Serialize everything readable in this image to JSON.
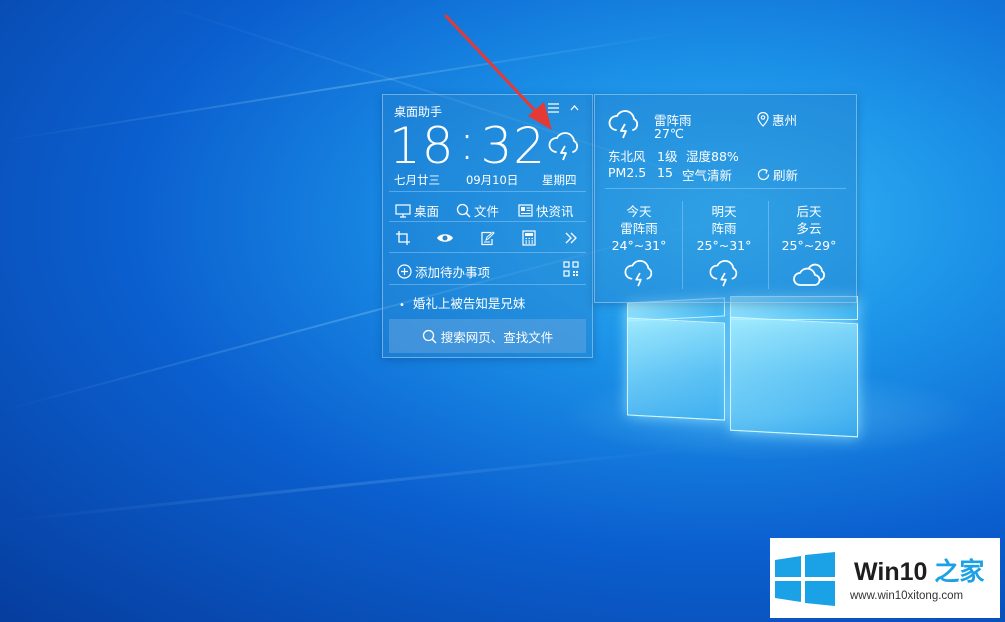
{
  "assistant": {
    "title": "桌面助手",
    "time_hour": "18",
    "time_sep": ":",
    "time_min": "32",
    "lunar_date": "七月廿三",
    "date": "09月10日",
    "weekday": "星期四",
    "nav": [
      {
        "label": "桌面",
        "icon": "monitor-icon"
      },
      {
        "label": "文件",
        "icon": "search-icon"
      },
      {
        "label": "快资讯",
        "icon": "news-icon"
      }
    ],
    "tools": [
      "crop-icon",
      "eye-icon",
      "edit-icon",
      "calculator-icon",
      "double-chevron-right-icon"
    ],
    "todo_label": "添加待办事项",
    "note_bullet": "•",
    "note": "婚礼上被告知是兄妹",
    "search_label": "搜索网页、查找文件"
  },
  "weather": {
    "condition": "雷阵雨",
    "temperature": "27℃",
    "location": "惠州",
    "wind_dir": "东北风",
    "wind_level": "1级",
    "humidity": "湿度88%",
    "pm_label": "PM2.5",
    "pm_value": "15",
    "air_quality": "空气清新",
    "refresh_label": "刷新",
    "forecast": [
      {
        "day": "今天",
        "condition": "雷阵雨",
        "range": "24°~31°",
        "icon": "thunderstorm-icon"
      },
      {
        "day": "明天",
        "condition": "阵雨",
        "range": "25°~31°",
        "icon": "thunderstorm-icon"
      },
      {
        "day": "后天",
        "condition": "多云",
        "range": "25°~29°",
        "icon": "cloudy-icon"
      }
    ]
  },
  "watermark": {
    "title_main": "Win10",
    "title_accent": " 之家",
    "url": "www.win10xitong.com",
    "accent_color": "#1aa1e6"
  },
  "annotation_color": "#e53935"
}
